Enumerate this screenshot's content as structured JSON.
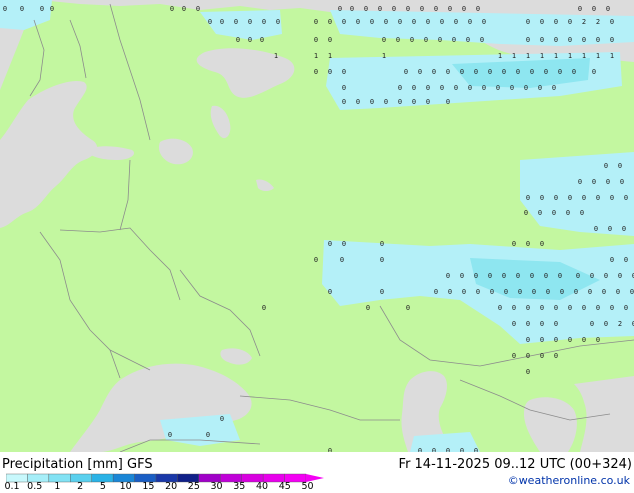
{
  "map": {
    "ocean_color": "#dcdcdc",
    "land_color": "#c3f7a0",
    "precip_light_color": "#b4f0f8",
    "precip_mid_color": "#8ee6f0",
    "border_color": "#8c8c8c",
    "marker_labels": {
      "zero": "0",
      "one": "1",
      "two": "2"
    }
  },
  "footer": {
    "title": "Precipitation [mm]  GFS",
    "run_info": "Fr 14-11-2025 09..12 UTC (00+324)",
    "credit": "©weatheronline.co.uk",
    "scale": {
      "labels": [
        "0.1",
        "0.5",
        "1",
        "2",
        "5",
        "10",
        "15",
        "20",
        "25",
        "30",
        "35",
        "40",
        "45",
        "50"
      ],
      "colors": [
        "#c8f8fc",
        "#a6eef8",
        "#82e2f4",
        "#5ad0ee",
        "#2ab2e6",
        "#1a86d6",
        "#1a5ec4",
        "#1a38a8",
        "#102088",
        "#a000c8",
        "#c000d8",
        "#d800e0",
        "#e800ec",
        "#f400f4"
      ]
    }
  }
}
